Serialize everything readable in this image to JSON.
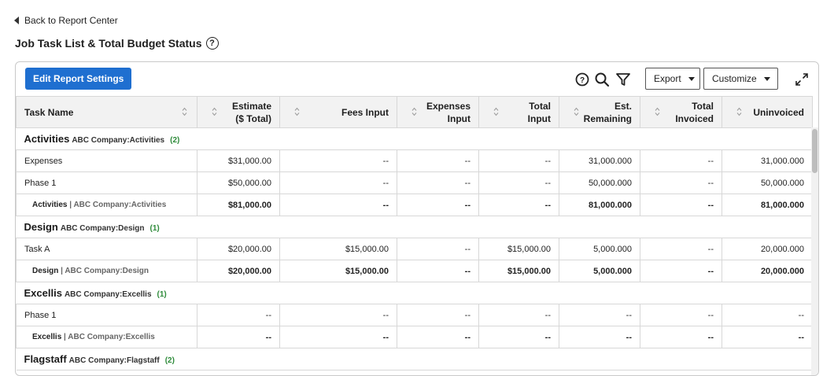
{
  "back_link": "Back to Report Center",
  "page_title": "Job Task List & Total Budget Status",
  "toolbar": {
    "edit_label": "Edit Report Settings",
    "export_label": "Export",
    "customize_label": "Customize"
  },
  "columns": [
    {
      "line1": "Task Name",
      "line2": ""
    },
    {
      "line1": "Estimate",
      "line2": "($ Total)"
    },
    {
      "line1": "Fees Input",
      "line2": ""
    },
    {
      "line1": "Expenses",
      "line2": "Input"
    },
    {
      "line1": "Total",
      "line2": "Input"
    },
    {
      "line1": "Est.",
      "line2": "Remaining"
    },
    {
      "line1": "Total",
      "line2": "Invoiced"
    },
    {
      "line1": "Uninvoiced",
      "line2": ""
    }
  ],
  "groups": [
    {
      "name": "Activities",
      "path": "ABC Company:Activities",
      "count": "(2)",
      "rows": [
        {
          "name": "Expenses",
          "cells": [
            "$31,000.00",
            "--",
            "--",
            "--",
            "31,000.000",
            "--",
            "31,000.000"
          ]
        },
        {
          "name": "Phase 1",
          "cells": [
            "$50,000.00",
            "--",
            "--",
            "--",
            "50,000.000",
            "--",
            "50,000.000"
          ]
        }
      ],
      "subtotal": {
        "name": "Activities",
        "path": "ABC Company:Activities",
        "cells": [
          "$81,000.00",
          "--",
          "--",
          "--",
          "81,000.000",
          "--",
          "81,000.000"
        ]
      }
    },
    {
      "name": "Design",
      "path": "ABC Company:Design",
      "count": "(1)",
      "rows": [
        {
          "name": "Task A",
          "cells": [
            "$20,000.00",
            "$15,000.00",
            "--",
            "$15,000.00",
            "5,000.000",
            "--",
            "20,000.000"
          ]
        }
      ],
      "subtotal": {
        "name": "Design",
        "path": "ABC Company:Design",
        "cells": [
          "$20,000.00",
          "$15,000.00",
          "--",
          "$15,000.00",
          "5,000.000",
          "--",
          "20,000.000"
        ]
      }
    },
    {
      "name": "Excellis",
      "path": "ABC Company:Excellis",
      "count": "(1)",
      "rows": [
        {
          "name": "Phase 1",
          "cells": [
            "--",
            "--",
            "--",
            "--",
            "--",
            "--",
            "--"
          ]
        }
      ],
      "subtotal": {
        "name": "Excellis",
        "path": "ABC Company:Excellis",
        "cells": [
          "--",
          "--",
          "--",
          "--",
          "--",
          "--",
          "--"
        ]
      }
    },
    {
      "name": "Flagstaff",
      "path": "ABC Company:Flagstaff",
      "count": "(2)",
      "rows": [],
      "subtotal": null
    }
  ]
}
